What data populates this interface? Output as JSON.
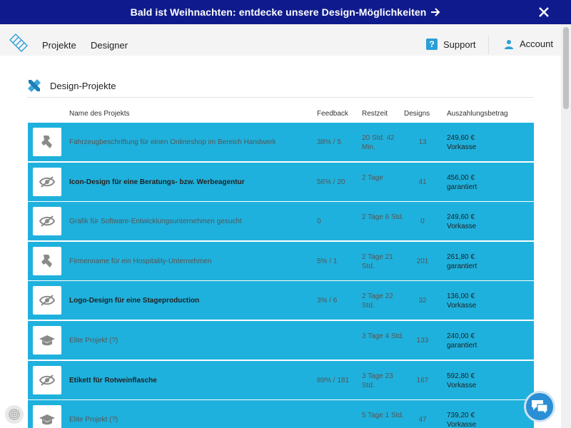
{
  "promo": {
    "text": "Bald ist Weihnachten: entdecke unsere Design-Möglichkeiten",
    "arrow_icon": "arrow-right-icon",
    "close_icon": "close-icon"
  },
  "nav": {
    "logo_icon": "logo-icon",
    "links": [
      "Projekte",
      "Designer"
    ],
    "support": "Support",
    "support_icon": "question-icon",
    "account": "Account",
    "account_icon": "user-icon"
  },
  "section": {
    "title": "Design-Projekte",
    "icon": "ruler-pencil-icon"
  },
  "table": {
    "headers": {
      "name": "Name des Projekts",
      "feedback": "Feedback",
      "rest": "Restzeit",
      "designs": "Designs",
      "payout": "Auszahlungsbetrag"
    },
    "rows": [
      {
        "icon": "wrench-icon",
        "name": "Fahrzeugbeschriftung für einen Onlineshop im Bereich Handwerk",
        "bold": false,
        "feedback": "38% / 5",
        "rest": "20 Std. 42 Min.",
        "designs": "13",
        "amount": "249,60 €",
        "payment": "Vorkasse"
      },
      {
        "icon": "eye-off-icon",
        "name": "Icon-Design für eine Beratungs- bzw. Werbeagentur",
        "bold": true,
        "feedback": "56% / 20",
        "rest": "2 Tage",
        "designs": "41",
        "amount": "456,00 €",
        "payment": "garantiert"
      },
      {
        "icon": "eye-off-icon",
        "name": "Grafik für Software-Entwicklungsunternehmen gesucht",
        "bold": false,
        "feedback": "0",
        "rest": "2 Tage 6 Std.",
        "designs": "0",
        "amount": "249,60 €",
        "payment": "Vorkasse"
      },
      {
        "icon": "wrench-icon",
        "name": "Firmenname für ein Hospitality-Unternehmen",
        "bold": false,
        "feedback": "5% / 1",
        "rest": "2 Tage 21 Std.",
        "designs": "201",
        "amount": "261,80 €",
        "payment": "garantiert"
      },
      {
        "icon": "eye-off-icon",
        "name": "Logo-Design für eine Stageproduction",
        "bold": true,
        "feedback": "3% / 6",
        "rest": "2 Tage 22 Std.",
        "designs": "32",
        "amount": "136,00 €",
        "payment": "Vorkasse"
      },
      {
        "icon": "graduation-cap-icon",
        "name": "Elite Projekt (?)",
        "bold": false,
        "feedback": "",
        "rest": "3 Tage 4 Std.",
        "designs": "133",
        "amount": "240,00 €",
        "payment": "garantiert"
      },
      {
        "icon": "eye-off-icon",
        "name": "Etikett für Rotweinflasche",
        "bold": true,
        "feedback": "89% / 181",
        "rest": "3 Tage 23 Std.",
        "designs": "167",
        "amount": "592,80 €",
        "payment": "Vorkasse"
      },
      {
        "icon": "graduation-cap-icon",
        "name": "Elite Projekt (?)",
        "bold": false,
        "feedback": "",
        "rest": "5 Tage 1 Std.",
        "designs": "47",
        "amount": "739,20 €",
        "payment": "Vorkasse"
      }
    ]
  },
  "widgets": {
    "chat_icon": "chat-icon",
    "fingerprint_icon": "fingerprint-icon"
  },
  "colors": {
    "promo_bg": "#0f1b8c",
    "row_bg": "#1fb1dd",
    "accent": "#2a9fd6"
  }
}
